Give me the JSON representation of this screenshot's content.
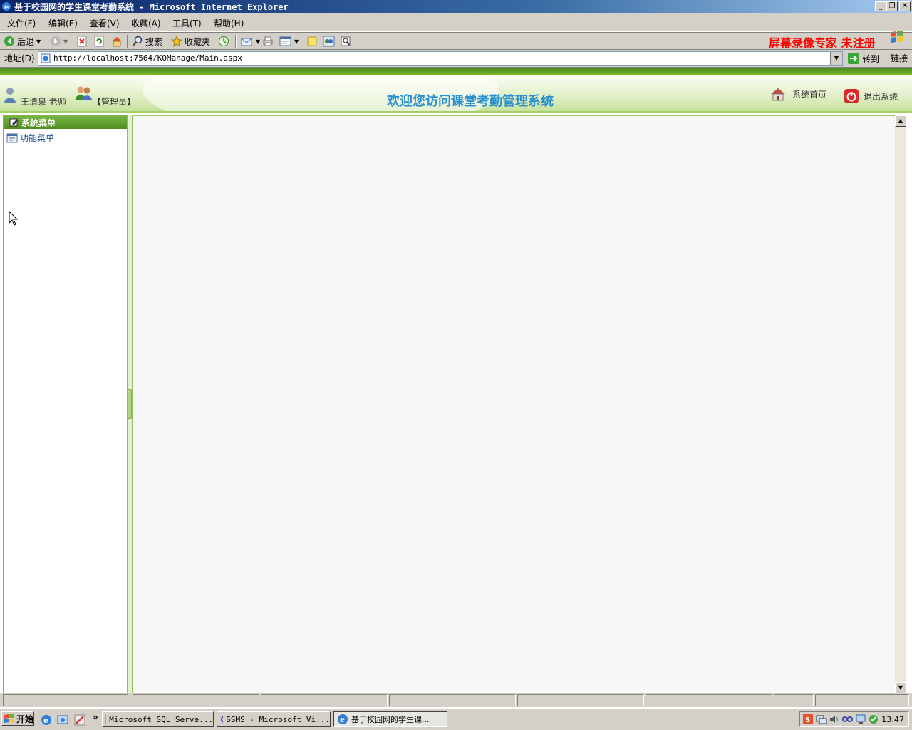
{
  "window": {
    "title": "基于校园网的学生课堂考勤系统 - Microsoft Internet Explorer"
  },
  "menubar": {
    "items": [
      "文件(F)",
      "编辑(E)",
      "查看(V)",
      "收藏(A)",
      "工具(T)",
      "帮助(H)"
    ],
    "watermark": "屏幕录像专家 未注册"
  },
  "toolbar": {
    "back_label": "后退",
    "search_label": "搜索",
    "favorites_label": "收藏夹"
  },
  "addressbar": {
    "label": "地址(D)",
    "url": "http://localhost:7564/KQManage/Main.aspx",
    "go_label": "转到",
    "links_label": "链接"
  },
  "page": {
    "user_name": "王清泉 老师",
    "role": "【管理员】",
    "welcome": "欢迎您访问课堂考勤管理系统",
    "home_link": "系统首页",
    "logout_link": "退出系统",
    "sidebar_title": "系统菜单",
    "sidebar_item": "功能菜单"
  },
  "taskbar": {
    "start_label": "开始",
    "tasks": [
      "Microsoft SQL Serve...",
      "SSMS - Microsoft Vi...",
      "基于校园网的学生课..."
    ],
    "clock": "13:47"
  },
  "colors": {
    "brand_green": "#6aa832",
    "welcome_blue": "#2a8fd0",
    "watermark_red": "#ff0000"
  }
}
